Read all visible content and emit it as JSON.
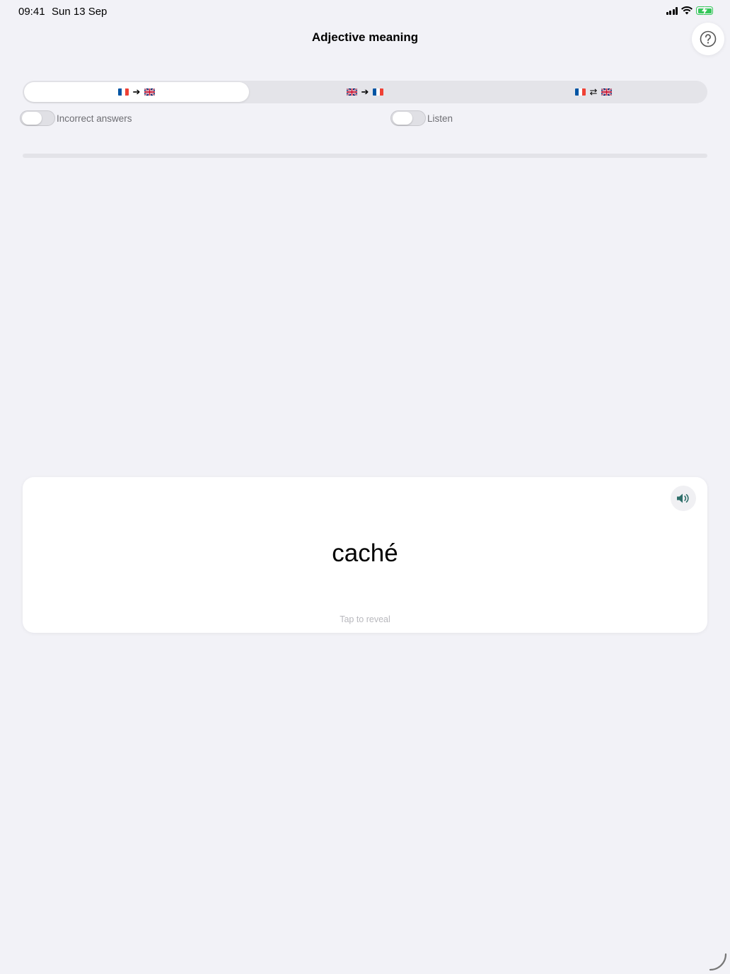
{
  "status_bar": {
    "time": "09:41",
    "date": "Sun 13 Sep"
  },
  "header": {
    "title": "Adjective meaning"
  },
  "direction_tabs": {
    "selected_index": 0,
    "items": [
      {
        "from": "french-flag-icon",
        "arrow": "➔",
        "to": "uk-flag-icon"
      },
      {
        "from": "uk-flag-icon",
        "arrow": "➔",
        "to": "french-flag-icon"
      },
      {
        "from": "french-flag-icon",
        "arrow": "⇄",
        "to": "uk-flag-icon"
      }
    ]
  },
  "toggles": {
    "incorrect_answers": {
      "label": "Incorrect answers",
      "on": false
    },
    "listen": {
      "label": "Listen",
      "on": false
    }
  },
  "progress": {
    "value": 0
  },
  "card": {
    "word": "caché",
    "hint": "Tap to reveal"
  },
  "colors": {
    "accent_green": "#34c759",
    "speaker_teal": "#2f6f6a",
    "background": "#f2f2f7"
  }
}
